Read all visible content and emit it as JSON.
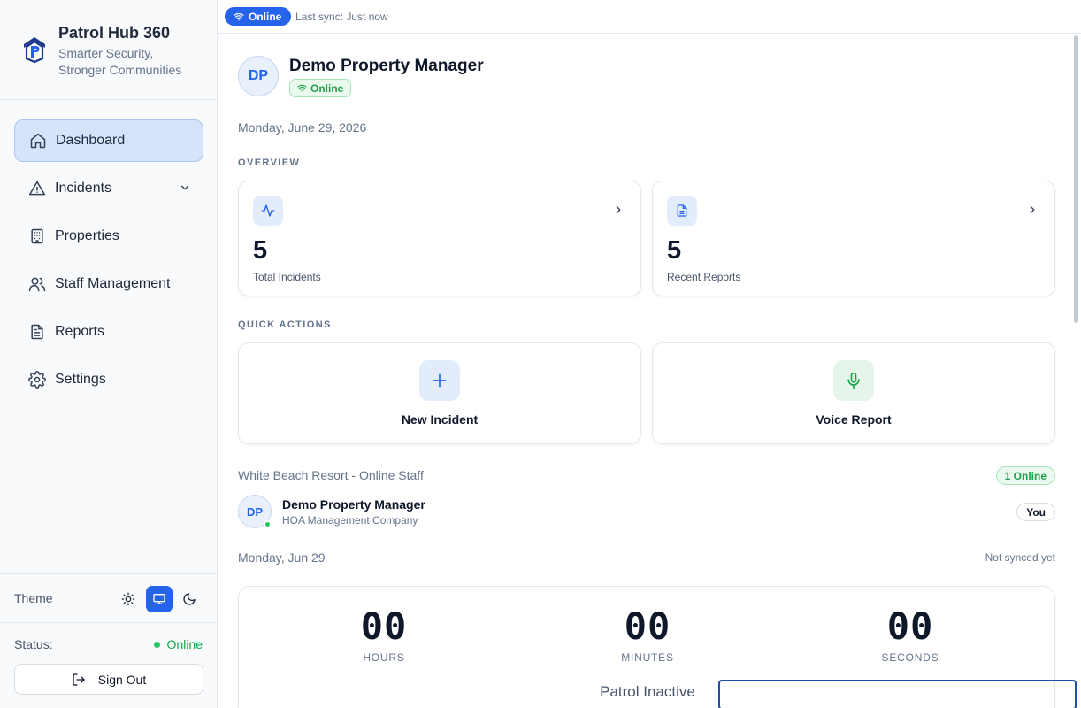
{
  "brand": {
    "title": "Patrol Hub 360",
    "tagline": "Smarter Security, Stronger Communities"
  },
  "nav": {
    "items": [
      {
        "label": "Dashboard",
        "icon": "home-icon",
        "active": true
      },
      {
        "label": "Incidents",
        "icon": "alert-triangle-icon",
        "has_dropdown": true
      },
      {
        "label": "Properties",
        "icon": "building-icon"
      },
      {
        "label": "Staff Management",
        "icon": "users-icon"
      },
      {
        "label": "Reports",
        "icon": "file-text-icon"
      },
      {
        "label": "Settings",
        "icon": "gear-icon"
      }
    ]
  },
  "theme": {
    "label": "Theme",
    "options": [
      "light",
      "system",
      "dark"
    ],
    "selected": "system"
  },
  "status": {
    "label": "Status:",
    "value": "Online"
  },
  "signout": {
    "label": "Sign Out"
  },
  "topbar": {
    "online_label": "Online",
    "sync_text": "Last sync: Just now"
  },
  "profile": {
    "initials": "DP",
    "name": "Demo Property Manager",
    "status": "Online"
  },
  "date_long": "Monday, June 29, 2026",
  "overview": {
    "title": "OVERVIEW",
    "cards": [
      {
        "value": "5",
        "label": "Total Incidents",
        "icon": "activity-icon"
      },
      {
        "value": "5",
        "label": "Recent Reports",
        "icon": "file-text-icon"
      }
    ]
  },
  "quick_actions": {
    "title": "QUICK ACTIONS",
    "items": [
      {
        "label": "New Incident",
        "icon": "plus-icon",
        "color": "#2563eb"
      },
      {
        "label": "Voice Report",
        "icon": "microphone-icon",
        "color": "#16a34a"
      }
    ]
  },
  "staff": {
    "heading": "White Beach Resort - Online Staff",
    "count": "1 Online",
    "members": [
      {
        "initials": "DP",
        "name": "Demo Property Manager",
        "company": "HOA Management Company",
        "tag": "You"
      }
    ]
  },
  "patrol": {
    "date": "Monday, Jun 29",
    "sync_status": "Not synced yet",
    "hours": "00",
    "minutes": "00",
    "seconds": "00",
    "hours_label": "HOURS",
    "minutes_label": "MINUTES",
    "seconds_label": "SECONDS",
    "status": "Patrol Inactive"
  },
  "colors": {
    "accent": "#2563eb",
    "success": "#22c55e"
  }
}
